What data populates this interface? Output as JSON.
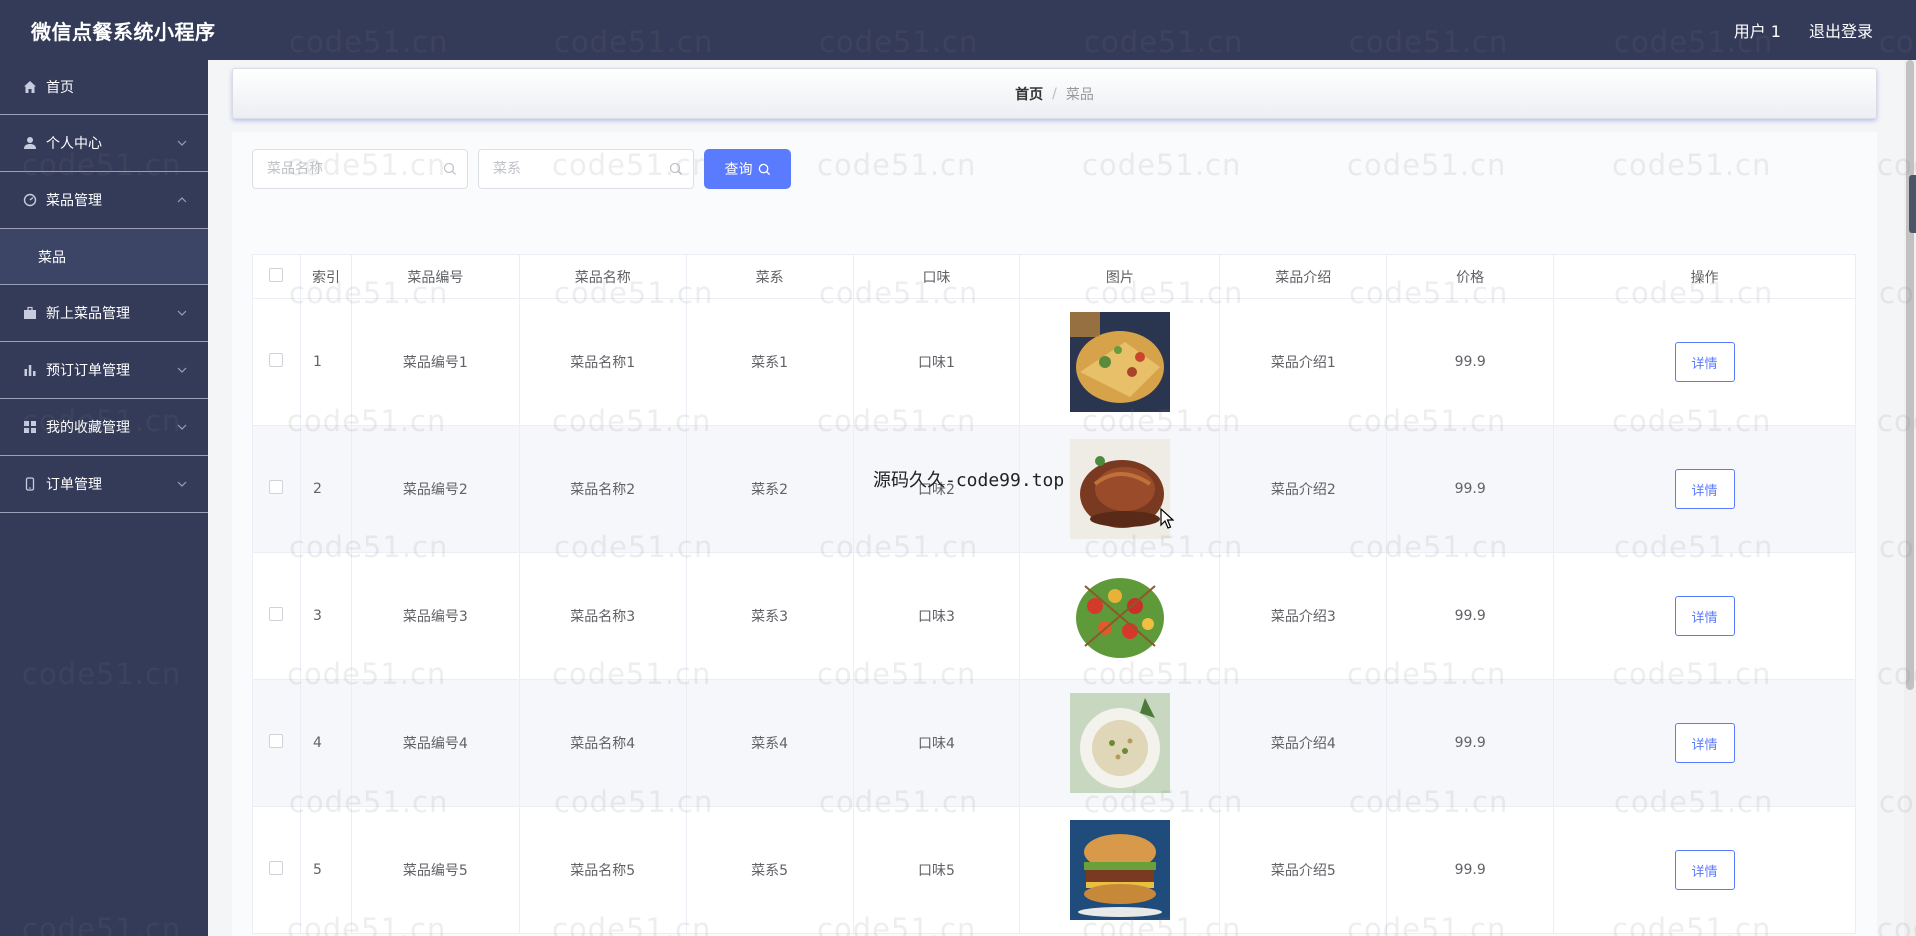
{
  "header": {
    "title": "微信点餐系统小程序",
    "user": "用户 1",
    "logout": "退出登录"
  },
  "sidebar": {
    "items": [
      {
        "label": "首页",
        "icon": "home-icon"
      },
      {
        "label": "个人中心",
        "icon": "user-icon"
      },
      {
        "label": "菜品管理",
        "icon": "dashboard-icon"
      },
      {
        "label": "菜品",
        "sub": true
      },
      {
        "label": "新上菜品管理",
        "icon": "briefcase-icon"
      },
      {
        "label": "预订订单管理",
        "icon": "bar-chart-icon"
      },
      {
        "label": "我的收藏管理",
        "icon": "grid-icon"
      },
      {
        "label": "订单管理",
        "icon": "mobile-icon"
      }
    ]
  },
  "breadcrumb": {
    "home": "首页",
    "separator": "/",
    "current": "菜品"
  },
  "search": {
    "name_placeholder": "菜品名称",
    "cuisine_placeholder": "菜系",
    "query_label": "查询"
  },
  "table": {
    "headers": [
      "索引",
      "菜品编号",
      "菜品名称",
      "菜系",
      "口味",
      "图片",
      "菜品介绍",
      "价格",
      "操作"
    ],
    "rows": [
      {
        "index": "1",
        "code": "菜品编号1",
        "name": "菜品名称1",
        "cuisine": "菜系1",
        "taste": "口味1",
        "intro": "菜品介绍1",
        "price": "99.9",
        "action": "详情"
      },
      {
        "index": "2",
        "code": "菜品编号2",
        "name": "菜品名称2",
        "cuisine": "菜系2",
        "taste": "口味2",
        "intro": "菜品介绍2",
        "price": "99.9",
        "action": "详情"
      },
      {
        "index": "3",
        "code": "菜品编号3",
        "name": "菜品名称3",
        "cuisine": "菜系3",
        "taste": "口味3",
        "intro": "菜品介绍3",
        "price": "99.9",
        "action": "详情"
      },
      {
        "index": "4",
        "code": "菜品编号4",
        "name": "菜品名称4",
        "cuisine": "菜系4",
        "taste": "口味4",
        "intro": "菜品介绍4",
        "price": "99.9",
        "action": "详情"
      },
      {
        "index": "5",
        "code": "菜品编号5",
        "name": "菜品名称5",
        "cuisine": "菜系5",
        "taste": "口味5",
        "intro": "菜品介绍5",
        "price": "99.9",
        "action": "详情"
      }
    ]
  },
  "overlay": {
    "text": "源码久久-code99.top",
    "watermark": "code51.cn"
  },
  "colors": {
    "sidebar_bg": "#343b58",
    "accent": "#5b7bff"
  }
}
